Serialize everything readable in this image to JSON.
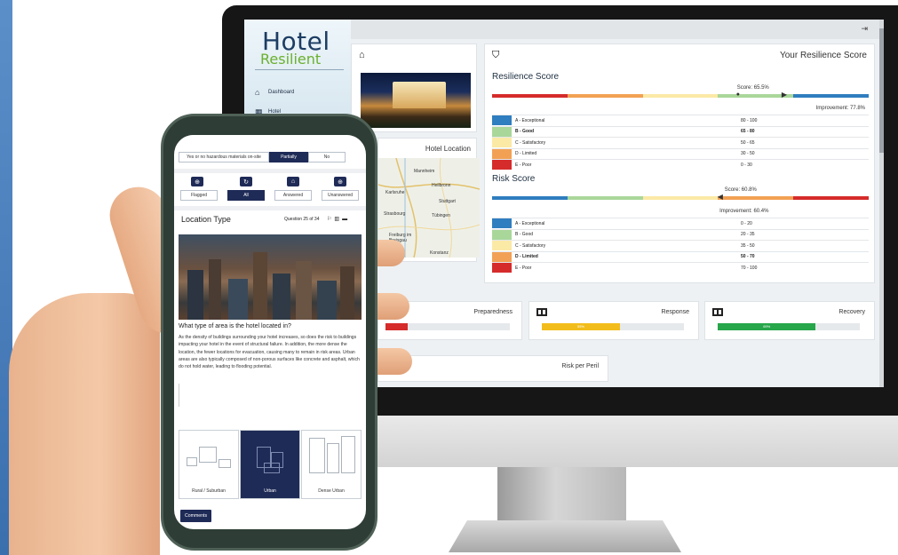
{
  "dashboard": {
    "logo_top": "Hotel",
    "logo_bottom": "Resilient",
    "nav": [
      {
        "label": "Dashboard",
        "icon": "home-icon"
      },
      {
        "label": "Hotel",
        "icon": "building-icon"
      }
    ],
    "hotel_location_title": "Hotel Location",
    "map_labels": [
      "Mannheim",
      "Heilbronn",
      "Karlsruhe",
      "Stuttgart",
      "Strasbourg",
      "Tübingen",
      "Freiburg im Breisgau",
      "Konstanz"
    ],
    "score_card_title": "Your Resilience Score",
    "resilience": {
      "title": "Resilience Score",
      "score_text": "Score: 65.5%",
      "improvement_text": "Improvement: 77.8%",
      "score": 65.5,
      "improvement": 77.8,
      "bar_colors": [
        "#d62b2b",
        "#f2a154",
        "#fbe9a6",
        "#a9d79a",
        "#2f7ebf"
      ],
      "legend": [
        {
          "label": "A - Exceptional",
          "range": "80 - 100",
          "color": "#2f7ebf",
          "bold": false
        },
        {
          "label": "B - Good",
          "range": "65 - 80",
          "color": "#a9d79a",
          "bold": true
        },
        {
          "label": "C - Satisfactory",
          "range": "50 - 65",
          "color": "#fbe9a6",
          "bold": false
        },
        {
          "label": "D - Limited",
          "range": "30 - 50",
          "color": "#f2a154",
          "bold": false
        },
        {
          "label": "E - Poor",
          "range": "0 - 30",
          "color": "#d62b2b",
          "bold": false
        }
      ]
    },
    "risk": {
      "title": "Risk Score",
      "score_text": "Score: 60.8%",
      "improvement_text": "Improvement: 60.4%",
      "score": 60.8,
      "improvement": 60.4,
      "bar_colors": [
        "#2f7ebf",
        "#a9d79a",
        "#fbe9a6",
        "#f2a154",
        "#d62b2b"
      ],
      "legend": [
        {
          "label": "A - Exceptional",
          "range": "0 - 20",
          "color": "#2f7ebf",
          "bold": false
        },
        {
          "label": "B - Good",
          "range": "20 - 35",
          "color": "#a9d79a",
          "bold": false
        },
        {
          "label": "C - Satisfactory",
          "range": "35 - 50",
          "color": "#fbe9a6",
          "bold": false
        },
        {
          "label": "D - Limited",
          "range": "50 - 70",
          "color": "#f2a154",
          "bold": true
        },
        {
          "label": "E - Poor",
          "range": "70 - 100",
          "color": "#d62b2b",
          "bold": false
        }
      ]
    },
    "metrics": [
      {
        "title": "Preparedness",
        "value": 0.18,
        "color": "#d62b2b",
        "fill_label": ""
      },
      {
        "title": "Response",
        "value": 0.55,
        "color": "#f2bd1b",
        "fill_label": "55%"
      },
      {
        "title": "Recovery",
        "value": 0.69,
        "color": "#27a64a",
        "fill_label": "69%"
      }
    ],
    "risk_per_peril_title": "Risk per Peril"
  },
  "phone": {
    "prev_question_text": "Yes or no hazardous materials on-site",
    "prev_answer_partially": "Partially",
    "prev_answer_no": "No",
    "filters": [
      {
        "label": "Flagged",
        "icon": "flag-icon",
        "glyph": "⊕"
      },
      {
        "label": "All",
        "icon": "refresh-icon",
        "glyph": "↻"
      },
      {
        "label": "Answered",
        "icon": "home-icon",
        "glyph": "⌂"
      },
      {
        "label": "Unanswered",
        "icon": "circle-arrow-icon",
        "glyph": "⊕"
      }
    ],
    "section_title": "Location Type",
    "question_counter": "Question 25 of 34",
    "question": "What type of area is the hotel located in?",
    "description": "As the density of buildings surrounding your hotel increases, so does the risk to buildings impacting your hotel in the event of structural failure. In addition, the more dense the location, the fewer locations for evacuation, causing many to remain in risk areas. Urban areas are also typically composed of non-porous surfaces like concrete and asphalt, which do not hold water, leading to flooding potential.",
    "options": [
      {
        "label": "Rural / Suburban",
        "selected": false
      },
      {
        "label": "Urban",
        "selected": true
      },
      {
        "label": "Dense Urban",
        "selected": false
      }
    ],
    "comments_label": "Comments"
  }
}
